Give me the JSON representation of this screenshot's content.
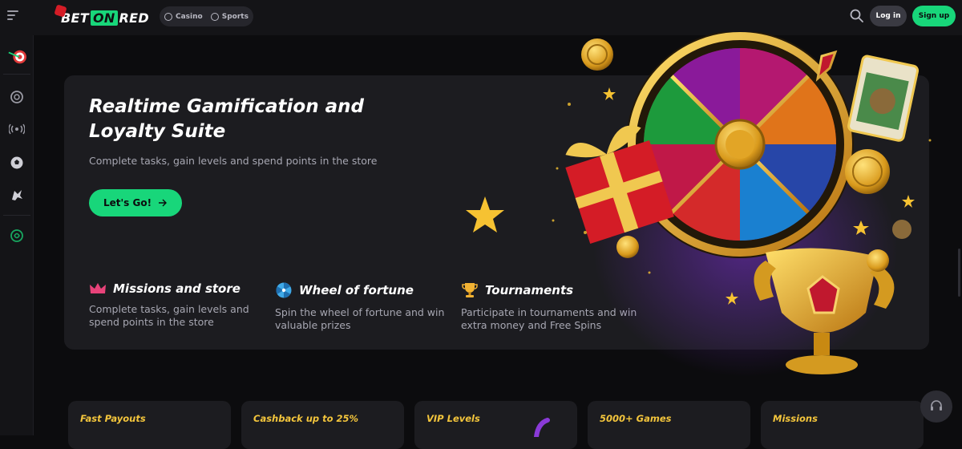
{
  "brand": {
    "part1": "BET",
    "part2": "ON",
    "part3": "RED"
  },
  "topnav": {
    "tabs": [
      {
        "label": "Casino",
        "icon": "casino-chip-icon"
      },
      {
        "label": "Sports",
        "icon": "soccer-ball-icon"
      }
    ]
  },
  "header": {
    "login_label": "Log in",
    "signup_label": "Sign up"
  },
  "sidebar": {
    "items": [
      {
        "icon": "dart-target-icon"
      },
      {
        "icon": "casino-chip-icon"
      },
      {
        "icon": "live-broadcast-icon"
      },
      {
        "icon": "soccer-ball-icon"
      },
      {
        "icon": "esports-icon"
      },
      {
        "icon": "green-swirl-icon"
      }
    ]
  },
  "hero": {
    "title": "Realtime Gamification and Loyalty Suite",
    "subtitle": "Complete tasks, gain levels and spend points in the store",
    "cta_label": "Let's Go!",
    "features": [
      {
        "icon": "crown-icon",
        "title": "Missions and store",
        "desc": "Complete tasks, gain levels and spend points in the store"
      },
      {
        "icon": "wheel-icon",
        "title": "Wheel of fortune",
        "desc": "Spin the wheel of fortune and win valuable prizes"
      },
      {
        "icon": "trophy-icon",
        "title": "Tournaments",
        "desc": "Participate in tournaments and win extra money and Free Spins"
      }
    ]
  },
  "bottom_cards": [
    "Fast Payouts",
    "Cashback up to 25%",
    "VIP Levels",
    "5000+ Games",
    "Missions"
  ],
  "colors": {
    "accent_green": "#18d67a",
    "brand_red": "#d41c26",
    "gold": "#f3c53c",
    "panel": "#1c1c20",
    "background": "#0c0c0e"
  }
}
